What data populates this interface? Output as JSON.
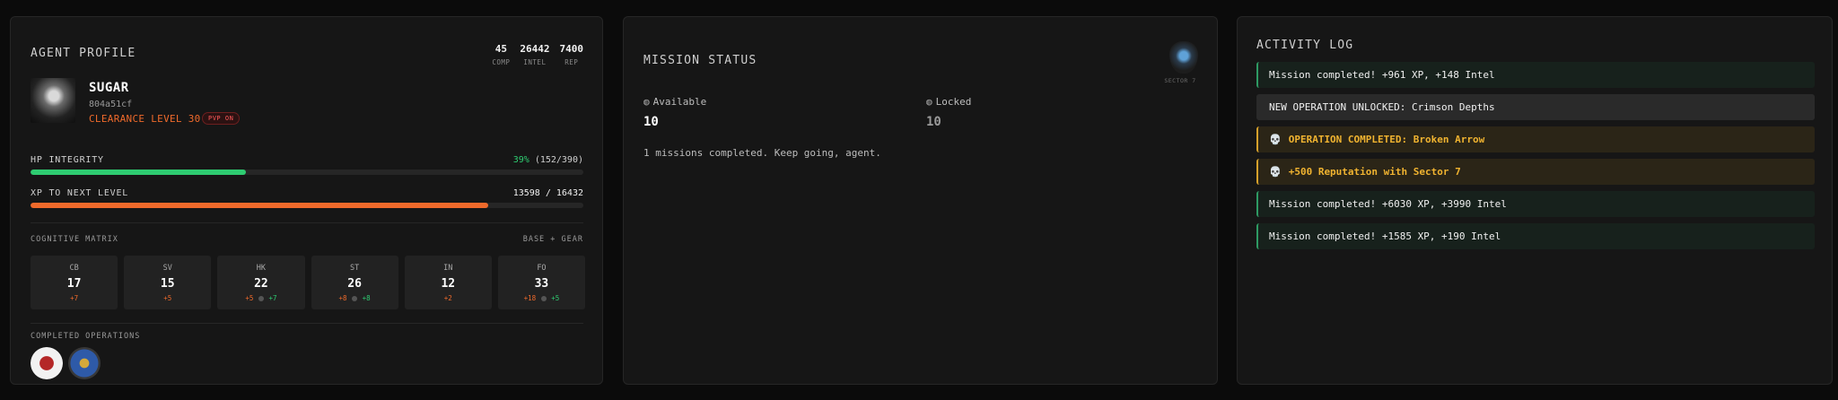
{
  "profile": {
    "title": "AGENT PROFILE",
    "stats": [
      {
        "value": "45",
        "label": "COMP"
      },
      {
        "value": "26442",
        "label": "INTEL"
      },
      {
        "value": "7400",
        "label": "REP"
      }
    ],
    "name": "SUGAR",
    "id": "804a51cf",
    "clearance": "CLEARANCE LEVEL 30",
    "pvp": "PVP ON",
    "hp": {
      "label": "HP INTEGRITY",
      "percent": "39%",
      "detail": "(152/390)",
      "fraction": 0.39
    },
    "xp": {
      "label": "XP TO NEXT LEVEL",
      "detail": "13598 / 16432",
      "fraction": 0.8275
    },
    "cognitive": {
      "label": "COGNITIVE MATRIX",
      "right_label": "BASE + GEAR",
      "cells": [
        {
          "key": "CB",
          "value": "17",
          "base": "+7",
          "gear": ""
        },
        {
          "key": "SV",
          "value": "15",
          "base": "+5",
          "gear": ""
        },
        {
          "key": "HK",
          "value": "22",
          "base": "+5",
          "gear": "+7"
        },
        {
          "key": "ST",
          "value": "26",
          "base": "+8",
          "gear": "+8"
        },
        {
          "key": "IN",
          "value": "12",
          "base": "+2",
          "gear": ""
        },
        {
          "key": "FO",
          "value": "33",
          "base": "+18",
          "gear": "+5"
        }
      ]
    },
    "completed_ops_label": "COMPLETED OPERATIONS",
    "colors": {
      "hp": "#2ecc71",
      "xp": "#ef6a2b"
    }
  },
  "mission": {
    "title": "MISSION STATUS",
    "sector": "SECTOR 7",
    "available": {
      "label": "Available",
      "value": "10"
    },
    "locked": {
      "label": "Locked",
      "value": "10"
    },
    "note": "1 missions completed. Keep going, agent."
  },
  "log": {
    "title": "ACTIVITY LOG",
    "entries": [
      {
        "type": "normal",
        "text": "Mission completed! +961 XP, +148 Intel"
      },
      {
        "type": "unlock",
        "text": "NEW OPERATION UNLOCKED: Crimson Depths"
      },
      {
        "type": "gold",
        "text": "OPERATION COMPLETED: Broken Arrow"
      },
      {
        "type": "gold",
        "text": "+500 Reputation with Sector 7"
      },
      {
        "type": "normal",
        "text": "Mission completed! +6030 XP, +3990 Intel"
      },
      {
        "type": "normal",
        "text": "Mission completed! +1585 XP, +190 Intel"
      }
    ]
  }
}
